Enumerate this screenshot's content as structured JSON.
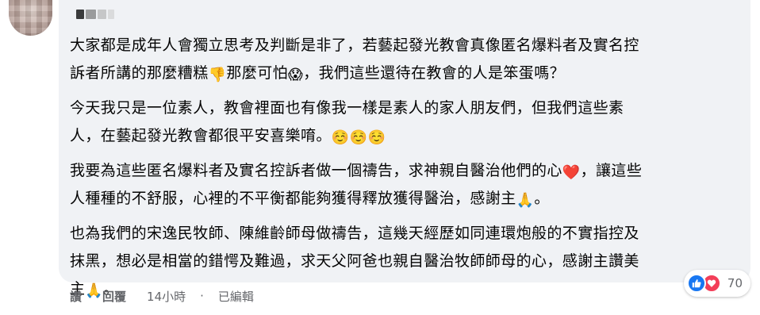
{
  "comment": {
    "paragraphs": [
      {
        "lines": [
          [
            {
              "t": "text",
              "v": "大家都是成年人會獨立思考及判斷是非了，若藝起發光教會真像匿名爆料者及實名控"
            }
          ],
          [
            {
              "t": "text",
              "v": "訴者所講的那麼糟糕"
            },
            {
              "t": "emoji",
              "v": "👎",
              "name": "thumbs-down-emoji"
            },
            {
              "t": "text",
              "v": "那麼可怕"
            },
            {
              "t": "emoji",
              "v": "😱",
              "name": "screaming-face-emoji"
            },
            {
              "t": "text",
              "v": "，我們這些還待在教會的人是笨蛋嗎？"
            }
          ]
        ]
      },
      {
        "lines": [
          [
            {
              "t": "text",
              "v": "今天我只是一位素人，教會裡面也有像我一樣是素人的家人朋友們，但我們這些素"
            }
          ],
          [
            {
              "t": "text",
              "v": "人，在藝起發光教會都很平安喜樂唷。"
            },
            {
              "t": "emoji",
              "v": "☺️",
              "name": "smiling-face-emoji"
            },
            {
              "t": "emoji",
              "v": "☺️",
              "name": "smiling-face-emoji"
            },
            {
              "t": "emoji",
              "v": "☺️",
              "name": "smiling-face-emoji"
            }
          ]
        ]
      },
      {
        "lines": [
          [
            {
              "t": "text",
              "v": "我要為這些匿名爆料者及實名控訴者做一個禱告，求神親自醫治他們的心"
            },
            {
              "t": "emoji",
              "v": "❤️",
              "name": "red-heart-emoji"
            },
            {
              "t": "text",
              "v": "，讓這些"
            }
          ],
          [
            {
              "t": "text",
              "v": "人種種的不舒服，心裡的不平衡都能夠獲得釋放獲得醫治，感謝主"
            },
            {
              "t": "emoji",
              "v": "🙏",
              "name": "praying-hands-emoji"
            },
            {
              "t": "text",
              "v": "。"
            }
          ]
        ]
      },
      {
        "lines": [
          [
            {
              "t": "text",
              "v": "也為我們的宋逸民牧師、陳維齡師母做禱告，這幾天經歷如同連環炮般的不實指控及"
            }
          ],
          [
            {
              "t": "text",
              "v": "抹黑，想必是相當的錯愕及難過，求天父阿爸也親自醫治牧師師母的心，感謝主讚美"
            }
          ],
          [
            {
              "t": "text",
              "v": "主"
            },
            {
              "t": "emoji",
              "v": "🙏",
              "name": "praying-hands-emoji"
            },
            {
              "t": "text",
              "v": "。"
            }
          ]
        ]
      }
    ]
  },
  "actions": {
    "like_label": "讚",
    "reply_label": "回覆",
    "timestamp": "14小時",
    "separator": "·",
    "edited_label": "已編輯"
  },
  "reactions": {
    "icons": [
      "like-icon",
      "love-icon"
    ],
    "count": "70"
  },
  "colors": {
    "bubble_bg": "#f0f2f5",
    "text": "#050505",
    "secondary_text": "#65676b",
    "like_blue": "#1877f2",
    "love_red": "#f33e58"
  }
}
